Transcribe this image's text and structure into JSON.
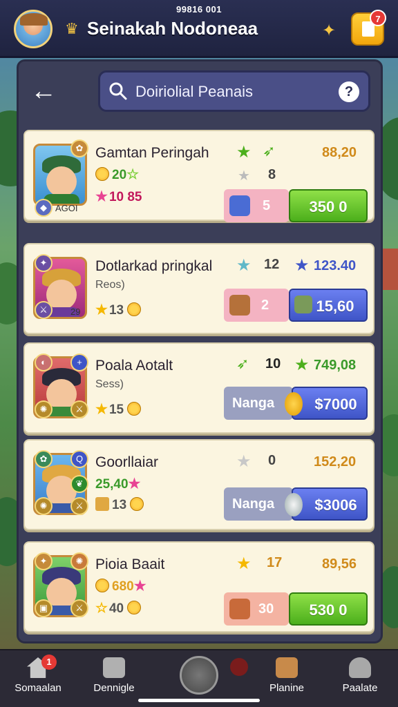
{
  "status": {
    "time": "99816 001"
  },
  "header": {
    "title": "Seinakah Nodoneaa",
    "notification_count": "7"
  },
  "search": {
    "placeholder": "Doiriolial Peanais",
    "help": "?"
  },
  "items": [
    {
      "name": "Gamtan Peringah",
      "stat1": "20",
      "stat2": "10 85",
      "badge_text": "AGOI",
      "rating": "8",
      "price_top": "88,20",
      "qty": "5",
      "button_price": "350 0",
      "button_color": "green",
      "price_top_color": "#d08a1a"
    },
    {
      "name": "Dotlarkad pringkal",
      "stat1": "Reos)",
      "stat2": "13",
      "badge_text": "29",
      "rating": "12",
      "price_top": "123.40",
      "qty": "2",
      "button_price": "15,60",
      "button_color": "blue",
      "price_top_color": "#3f55c7"
    },
    {
      "name": "Poala Aotalt",
      "stat1": "Sess)",
      "stat2": "15",
      "rating": "10",
      "price_top": "749,08",
      "qty_label": "Nanga",
      "button_price": "$7000",
      "button_color": "blue",
      "price_top_color": "#3a9a2a"
    },
    {
      "name": "Goorllaiar",
      "stat1": "25,40",
      "stat2": "13",
      "rating": "0",
      "price_top": "152,20",
      "qty_label": "Nanga",
      "button_price": "$3006",
      "button_color": "blue",
      "price_top_color": "#d08a1a"
    },
    {
      "name": "Pioia Baait",
      "stat1": "680",
      "stat2": "40",
      "rating": "17",
      "price_top": "89,56",
      "qty": "30",
      "button_price": "530 0",
      "button_color": "green",
      "price_top_color": "#d08a1a"
    }
  ],
  "nav": {
    "items": [
      "Somaalan",
      "Dennigle",
      "Planine",
      "Paalate"
    ],
    "badge": "1"
  },
  "icons": {
    "back": "arrow-left-icon",
    "search": "search-icon",
    "help": "question-icon",
    "crown": "crown-icon",
    "notification": "notification-icon"
  }
}
